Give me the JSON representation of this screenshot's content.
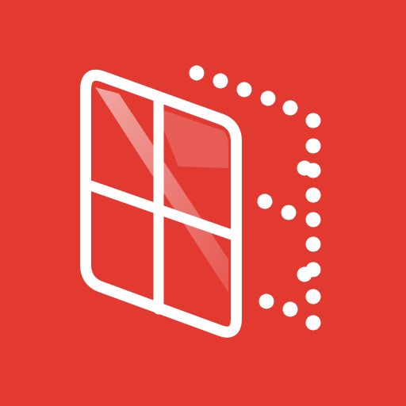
{
  "app_icon": {
    "name": "window-frame-app-icon",
    "colors": {
      "background": "#e23a31",
      "foreground": "#ffffff",
      "glare": "#f3a29c"
    },
    "elements": [
      "window-icon",
      "dotted-outline-icon"
    ]
  }
}
